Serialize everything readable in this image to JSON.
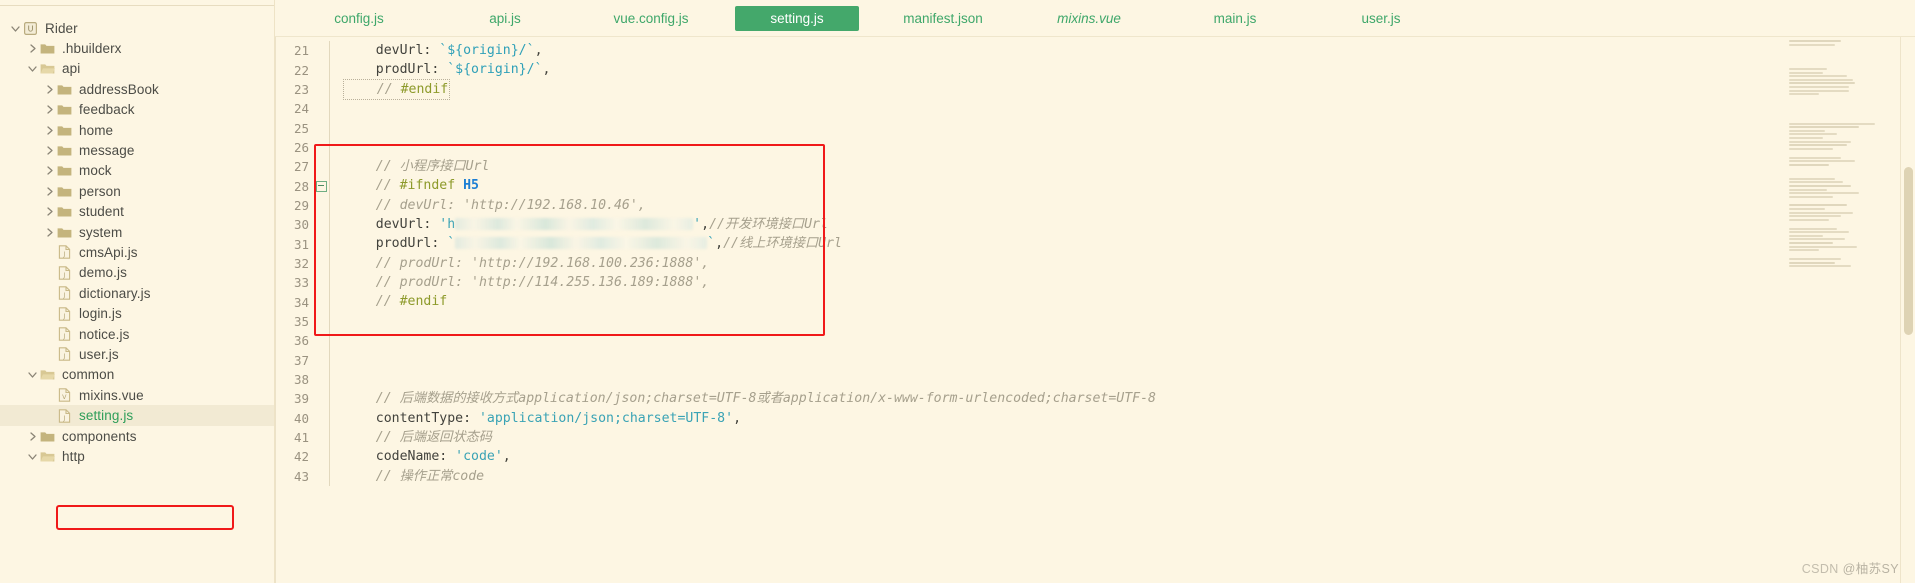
{
  "sidebar": {
    "items": [
      {
        "label": "Rider",
        "depth": 0,
        "arrow": "down",
        "icon": "module-icon",
        "selected": false
      },
      {
        "label": ".hbuilderx",
        "depth": 1,
        "arrow": "right",
        "icon": "folder-icon",
        "selected": false
      },
      {
        "label": "api",
        "depth": 1,
        "arrow": "down",
        "icon": "folder-open-icon",
        "selected": false
      },
      {
        "label": "addressBook",
        "depth": 2,
        "arrow": "right",
        "icon": "folder-icon",
        "selected": false
      },
      {
        "label": "feedback",
        "depth": 2,
        "arrow": "right",
        "icon": "folder-icon",
        "selected": false
      },
      {
        "label": "home",
        "depth": 2,
        "arrow": "right",
        "icon": "folder-icon",
        "selected": false
      },
      {
        "label": "message",
        "depth": 2,
        "arrow": "right",
        "icon": "folder-icon",
        "selected": false
      },
      {
        "label": "mock",
        "depth": 2,
        "arrow": "right",
        "icon": "folder-icon",
        "selected": false
      },
      {
        "label": "person",
        "depth": 2,
        "arrow": "right",
        "icon": "folder-icon",
        "selected": false
      },
      {
        "label": "student",
        "depth": 2,
        "arrow": "right",
        "icon": "folder-icon",
        "selected": false
      },
      {
        "label": "system",
        "depth": 2,
        "arrow": "right",
        "icon": "folder-icon",
        "selected": false
      },
      {
        "label": "cmsApi.js",
        "depth": 2,
        "arrow": "none",
        "icon": "js-file-icon",
        "selected": false
      },
      {
        "label": "demo.js",
        "depth": 2,
        "arrow": "none",
        "icon": "js-file-icon",
        "selected": false
      },
      {
        "label": "dictionary.js",
        "depth": 2,
        "arrow": "none",
        "icon": "js-file-icon",
        "selected": false
      },
      {
        "label": "login.js",
        "depth": 2,
        "arrow": "none",
        "icon": "js-file-icon",
        "selected": false
      },
      {
        "label": "notice.js",
        "depth": 2,
        "arrow": "none",
        "icon": "js-file-icon",
        "selected": false
      },
      {
        "label": "user.js",
        "depth": 2,
        "arrow": "none",
        "icon": "js-file-icon",
        "selected": false
      },
      {
        "label": "common",
        "depth": 1,
        "arrow": "down",
        "icon": "folder-open-icon",
        "selected": false
      },
      {
        "label": "mixins.vue",
        "depth": 2,
        "arrow": "none",
        "icon": "vue-file-icon",
        "selected": false
      },
      {
        "label": "setting.js",
        "depth": 2,
        "arrow": "none",
        "icon": "js-file-icon",
        "selected": true
      },
      {
        "label": "components",
        "depth": 1,
        "arrow": "right",
        "icon": "folder-icon",
        "selected": false
      },
      {
        "label": "http",
        "depth": 1,
        "arrow": "down",
        "icon": "folder-open-icon",
        "selected": false
      }
    ]
  },
  "tabs": [
    {
      "label": "config.js",
      "active": false,
      "italic": false
    },
    {
      "label": "api.js",
      "active": false,
      "italic": false
    },
    {
      "label": "vue.config.js",
      "active": false,
      "italic": false
    },
    {
      "label": "setting.js",
      "active": true,
      "italic": false
    },
    {
      "label": "manifest.json",
      "active": false,
      "italic": false
    },
    {
      "label": "mixins.vue",
      "active": false,
      "italic": true
    },
    {
      "label": "main.js",
      "active": false,
      "italic": false
    },
    {
      "label": "user.js",
      "active": false,
      "italic": false
    }
  ],
  "code": {
    "lines": [
      {
        "n": "21",
        "fold": false,
        "html": "<span class=\"plain\">    devUrl: </span><span class=\"tpl\">`${origin}/`</span><span class=\"pn\">,</span>"
      },
      {
        "n": "22",
        "fold": false,
        "html": "<span class=\"plain\">    prodUrl: </span><span class=\"tpl\">`${origin}/`</span><span class=\"pn\">,</span>"
      },
      {
        "n": "23",
        "fold": false,
        "html": "<span class=\"endif-sel\"><span class=\"cm\">    // </span><span class=\"cm-b\">#endif</span></span>"
      },
      {
        "n": "24",
        "fold": false,
        "html": ""
      },
      {
        "n": "25",
        "fold": false,
        "html": ""
      },
      {
        "n": "26",
        "fold": false,
        "html": ""
      },
      {
        "n": "27",
        "fold": false,
        "html": "<span class=\"cm\">    // 小程序接口Url</span>"
      },
      {
        "n": "28",
        "fold": true,
        "html": "<span class=\"cm\">    // </span><span class=\"cm-b\">#ifndef </span><span class=\"kw\">H5</span>"
      },
      {
        "n": "29",
        "fold": false,
        "html": "<span class=\"cm\">    // devUrl: 'http://192.168.10.46',</span>"
      },
      {
        "n": "30",
        "fold": false,
        "html": "<span class=\"plain\">    devUrl: </span><span class=\"str\">'h</span><span class=\"blur b1\"></span><span class=\"str\">'</span><span class=\"pn\">,</span><span class=\"cm\">//开发环境接口Url</span>"
      },
      {
        "n": "31",
        "fold": false,
        "html": "<span class=\"plain\">    prodUrl: </span><span class=\"tpl\">`</span><span class=\"blur b2\"></span><span class=\"tpl\">`</span><span class=\"pn\">,</span><span class=\"cm\">//线上环境接口Url</span>"
      },
      {
        "n": "32",
        "fold": false,
        "html": "<span class=\"cm\">    // prodUrl: 'http://192.168.100.236:1888',</span>"
      },
      {
        "n": "33",
        "fold": false,
        "html": "<span class=\"cm\">    // prodUrl: 'http://114.255.136.189:1888',</span>"
      },
      {
        "n": "34",
        "fold": false,
        "html": "<span class=\"cm\">    // </span><span class=\"cm-b\">#endif</span>"
      },
      {
        "n": "35",
        "fold": false,
        "html": ""
      },
      {
        "n": "36",
        "fold": false,
        "html": ""
      },
      {
        "n": "37",
        "fold": false,
        "html": ""
      },
      {
        "n": "38",
        "fold": false,
        "html": ""
      },
      {
        "n": "39",
        "fold": false,
        "html": "<span class=\"cm\">    // 后端数据的接收方式application/json;charset=UTF-8或者application/x-www-form-urlencoded;charset=UTF-8</span>"
      },
      {
        "n": "40",
        "fold": false,
        "html": "<span class=\"plain\">    contentType: </span><span class=\"str\">'application/json;charset=UTF-8'</span><span class=\"pn\">,</span>"
      },
      {
        "n": "41",
        "fold": false,
        "html": "<span class=\"cm\">    // 后端返回状态码</span>"
      },
      {
        "n": "42",
        "fold": false,
        "html": "<span class=\"plain\">    codeName: </span><span class=\"str\">'code'</span><span class=\"pn\">,</span>"
      },
      {
        "n": "43",
        "fold": false,
        "html": "<span class=\"cm\">    // 操作正常code</span>"
      }
    ]
  },
  "watermark": {
    "brand": "CSDN",
    "user": "@柚苏SY"
  },
  "colors": {
    "background": "#fdf6e3",
    "accent_green": "#44a86b",
    "highlight_red": "#f01919",
    "comment": "#a6a08d",
    "string": "#3aa3b5",
    "keyword": "#1d7fd4"
  }
}
